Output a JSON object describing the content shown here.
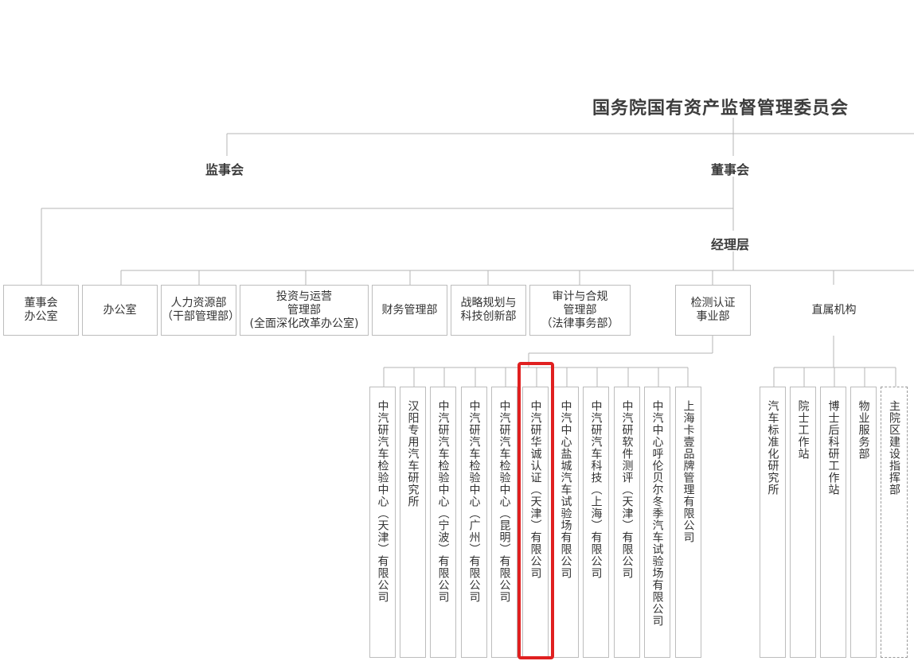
{
  "title": "国务院国有资产监督管理委员会",
  "labels": {
    "supervisory_board": "监事会",
    "board_of_directors": "董事会",
    "management": "经理层"
  },
  "departments": [
    {
      "text": "董事会\n办公室"
    },
    {
      "text": "办公室"
    },
    {
      "text": "人力资源部\n（干部管理部）"
    },
    {
      "text": "投资与运营\n管理部\n(全面深化改革办公室)"
    },
    {
      "text": "财务管理部"
    },
    {
      "text": "战略规划与\n科技创新部"
    },
    {
      "text": "审计与合规\n管理部\n（法律事务部）"
    },
    {
      "text": "检测认证\n事业部"
    },
    {
      "text": "直属机构"
    }
  ],
  "subsidiaries": [
    "中汽研汽车检验中心（天津）有限公司",
    "汉阳专用汽车研究所",
    "中汽研汽车检验中心（宁波）有限公司",
    "中汽研汽车检验中心（广州）有限公司",
    "中汽研汽车检验中心（昆明）有限公司",
    "中汽研华诚认证（天津）有限公司",
    "中汽中心盐城汽车试验场有限公司",
    "中汽研汽车科技（上海）有限公司",
    "中汽研软件测评（天津）有限公司",
    "中汽中心呼伦贝尔冬季汽车试验场有限公司",
    "上海卡壹品牌管理有限公司"
  ],
  "direct_units": [
    "汽车标准化研究所",
    "院士工作站",
    "博士后科研工作站",
    "物业服务部",
    "主院区建设指挥部"
  ],
  "highlighted_subsidiary": "中汽研华诚认证（天津）有限公司",
  "colors": {
    "line": "#b5b5b5",
    "border": "#bdbdbd",
    "highlight": "#e02020",
    "text": "#333333"
  }
}
